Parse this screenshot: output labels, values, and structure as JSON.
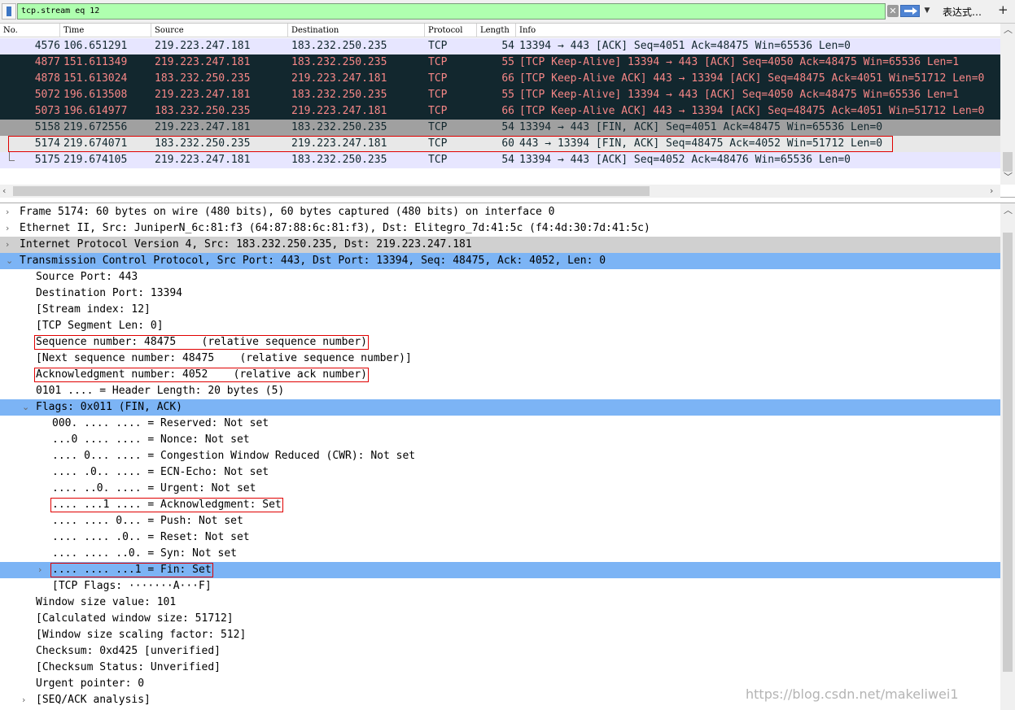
{
  "filter": {
    "value": "tcp.stream eq 12",
    "expression_label": "表达式…",
    "plus_label": "+"
  },
  "packet_list": {
    "columns": [
      "No.",
      "Time",
      "Source",
      "Destination",
      "Protocol",
      "Length",
      "Info"
    ],
    "rows": [
      {
        "no": "4576",
        "time": "106.651291",
        "source": "219.223.247.181",
        "destination": "183.232.250.235",
        "protocol": "TCP",
        "length": "54",
        "info": "13394 → 443 [ACK] Seq=4051 Ack=48475 Win=65536 Len=0",
        "style": "lav"
      },
      {
        "no": "4877",
        "time": "151.611349",
        "source": "219.223.247.181",
        "destination": "183.232.250.235",
        "protocol": "TCP",
        "length": "55",
        "info": "[TCP Keep-Alive] 13394 → 443 [ACK] Seq=4050 Ack=48475 Win=65536 Len=1",
        "style": "dark"
      },
      {
        "no": "4878",
        "time": "151.613024",
        "source": "183.232.250.235",
        "destination": "219.223.247.181",
        "protocol": "TCP",
        "length": "66",
        "info": "[TCP Keep-Alive ACK] 443 → 13394 [ACK] Seq=48475 Ack=4051 Win=51712 Len=0",
        "style": "dark"
      },
      {
        "no": "5072",
        "time": "196.613508",
        "source": "219.223.247.181",
        "destination": "183.232.250.235",
        "protocol": "TCP",
        "length": "55",
        "info": "[TCP Keep-Alive] 13394 → 443 [ACK] Seq=4050 Ack=48475 Win=65536 Len=1",
        "style": "dark"
      },
      {
        "no": "5073",
        "time": "196.614977",
        "source": "183.232.250.235",
        "destination": "219.223.247.181",
        "protocol": "TCP",
        "length": "66",
        "info": "[TCP Keep-Alive ACK] 443 → 13394 [ACK] Seq=48475 Ack=4051 Win=51712 Len=0",
        "style": "dark"
      },
      {
        "no": "5158",
        "time": "219.672556",
        "source": "219.223.247.181",
        "destination": "183.232.250.235",
        "protocol": "TCP",
        "length": "54",
        "info": "13394 → 443 [FIN, ACK] Seq=4051 Ack=48475 Win=65536 Len=0",
        "style": "gray"
      },
      {
        "no": "5174",
        "time": "219.674071",
        "source": "183.232.250.235",
        "destination": "219.223.247.181",
        "protocol": "TCP",
        "length": "60",
        "info": "443 → 13394 [FIN, ACK] Seq=48475 Ack=4052 Win=51712 Len=0",
        "style": "sel"
      },
      {
        "no": "5175",
        "time": "219.674105",
        "source": "219.223.247.181",
        "destination": "183.232.250.235",
        "protocol": "TCP",
        "length": "54",
        "info": "13394 → 443 [ACK] Seq=4052 Ack=48476 Win=65536 Len=0",
        "style": "lav"
      }
    ]
  },
  "details": {
    "lines": [
      {
        "text": "Frame 5174: 60 bytes on wire (480 bits), 60 bytes captured (480 bits) on interface 0",
        "indent": 0,
        "twisty": "closed",
        "style": "none",
        "box": false
      },
      {
        "text": "Ethernet II, Src: JuniperN_6c:81:f3 (64:87:88:6c:81:f3), Dst: Elitegro_7d:41:5c (f4:4d:30:7d:41:5c)",
        "indent": 0,
        "twisty": "closed",
        "style": "none",
        "box": false
      },
      {
        "text": "Internet Protocol Version 4, Src: 183.232.250.235, Dst: 219.223.247.181",
        "indent": 0,
        "twisty": "closed",
        "style": "gray",
        "box": false
      },
      {
        "text": "Transmission Control Protocol, Src Port: 443, Dst Port: 13394, Seq: 48475, Ack: 4052, Len: 0",
        "indent": 0,
        "twisty": "open",
        "style": "blue",
        "box": false
      },
      {
        "text": "Source Port: 443",
        "indent": 1,
        "twisty": "none",
        "style": "none",
        "box": false
      },
      {
        "text": "Destination Port: 13394",
        "indent": 1,
        "twisty": "none",
        "style": "none",
        "box": false
      },
      {
        "text": "[Stream index: 12]",
        "indent": 1,
        "twisty": "none",
        "style": "none",
        "box": false
      },
      {
        "text": "[TCP Segment Len: 0]",
        "indent": 1,
        "twisty": "none",
        "style": "none",
        "box": false
      },
      {
        "text": "Sequence number: 48475    (relative sequence number)",
        "indent": 1,
        "twisty": "none",
        "style": "none",
        "box": true
      },
      {
        "text": "[Next sequence number: 48475    (relative sequence number)]",
        "indent": 1,
        "twisty": "none",
        "style": "none",
        "box": false
      },
      {
        "text": "Acknowledgment number: 4052    (relative ack number)",
        "indent": 1,
        "twisty": "none",
        "style": "none",
        "box": true
      },
      {
        "text": "0101 .... = Header Length: 20 bytes (5)",
        "indent": 1,
        "twisty": "none",
        "style": "none",
        "box": false
      },
      {
        "text": "Flags: 0x011 (FIN, ACK)",
        "indent": 1,
        "twisty": "open",
        "style": "blue",
        "box": false
      },
      {
        "text": "000. .... .... = Reserved: Not set",
        "indent": 2,
        "twisty": "none",
        "style": "none",
        "box": false
      },
      {
        "text": "...0 .... .... = Nonce: Not set",
        "indent": 2,
        "twisty": "none",
        "style": "none",
        "box": false
      },
      {
        "text": ".... 0... .... = Congestion Window Reduced (CWR): Not set",
        "indent": 2,
        "twisty": "none",
        "style": "none",
        "box": false
      },
      {
        "text": ".... .0.. .... = ECN-Echo: Not set",
        "indent": 2,
        "twisty": "none",
        "style": "none",
        "box": false
      },
      {
        "text": ".... ..0. .... = Urgent: Not set",
        "indent": 2,
        "twisty": "none",
        "style": "none",
        "box": false
      },
      {
        "text": ".... ...1 .... = Acknowledgment: Set",
        "indent": 2,
        "twisty": "none",
        "style": "none",
        "box": true
      },
      {
        "text": ".... .... 0... = Push: Not set",
        "indent": 2,
        "twisty": "none",
        "style": "none",
        "box": false
      },
      {
        "text": ".... .... .0.. = Reset: Not set",
        "indent": 2,
        "twisty": "none",
        "style": "none",
        "box": false
      },
      {
        "text": ".... .... ..0. = Syn: Not set",
        "indent": 2,
        "twisty": "none",
        "style": "none",
        "box": false
      },
      {
        "text": ".... .... ...1 = Fin: Set",
        "indent": 2,
        "twisty": "closed",
        "style": "blue",
        "box": true
      },
      {
        "text": "[TCP Flags: ·······A···F]",
        "indent": 2,
        "twisty": "none",
        "style": "none",
        "box": false
      },
      {
        "text": "Window size value: 101",
        "indent": 1,
        "twisty": "none",
        "style": "none",
        "box": false
      },
      {
        "text": "[Calculated window size: 51712]",
        "indent": 1,
        "twisty": "none",
        "style": "none",
        "box": false
      },
      {
        "text": "[Window size scaling factor: 512]",
        "indent": 1,
        "twisty": "none",
        "style": "none",
        "box": false
      },
      {
        "text": "Checksum: 0xd425 [unverified]",
        "indent": 1,
        "twisty": "none",
        "style": "none",
        "box": false
      },
      {
        "text": "[Checksum Status: Unverified]",
        "indent": 1,
        "twisty": "none",
        "style": "none",
        "box": false
      },
      {
        "text": "Urgent pointer: 0",
        "indent": 1,
        "twisty": "none",
        "style": "none",
        "box": false
      },
      {
        "text": "[SEQ/ACK analysis]",
        "indent": 1,
        "twisty": "closed",
        "style": "none",
        "box": false
      }
    ]
  },
  "watermark": "https://blog.csdn.net/makeliwei1",
  "colors": {
    "filter_valid": "#afffaf",
    "row_lavender": "#e7e6ff",
    "row_dark_bg": "#12272e",
    "row_dark_fg": "#f78787",
    "row_gray": "#a0a0a0",
    "selection_blue": "#7cb4f5",
    "annotation_red": "#e00000"
  },
  "icons": [
    "bookmark-icon",
    "clear-filter-icon",
    "apply-filter-arrow-icon",
    "dropdown-chevron-icon",
    "add-button-icon"
  ]
}
